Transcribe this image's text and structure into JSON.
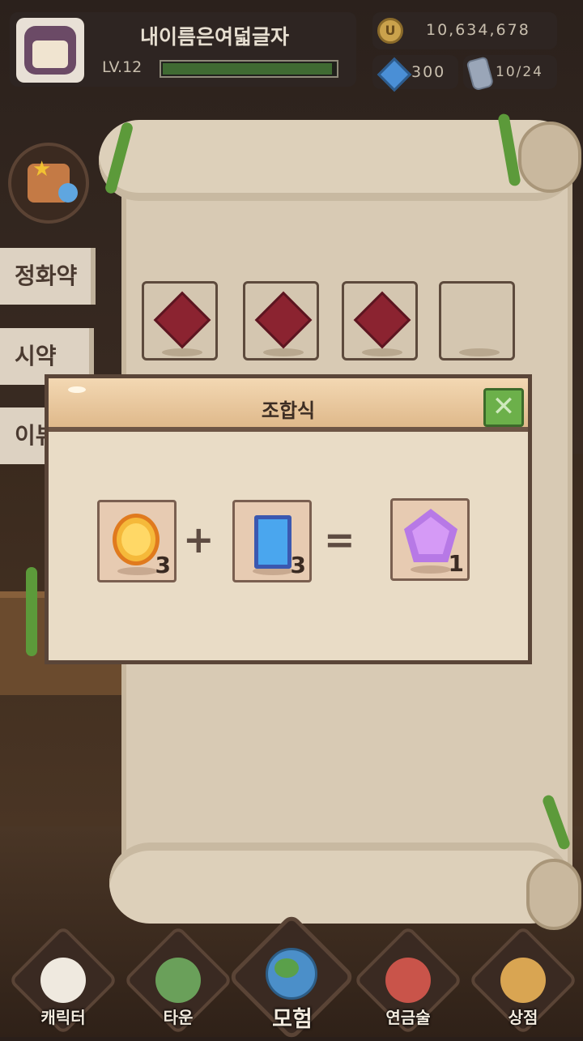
{
  "header": {
    "player_name": "내이름은여덟글자",
    "level": "LV.12",
    "xp_fraction": 0.98,
    "gold": "10,634,678",
    "gold_symbol": "U",
    "gems": "300",
    "stamina": "10/24"
  },
  "side_tabs": [
    "정화약",
    "시약",
    "이뷰"
  ],
  "modal": {
    "title": "조합식",
    "close_label": "✕",
    "ingredients": [
      {
        "item": "gold-coin",
        "qty": "3"
      },
      {
        "item": "blue-card",
        "qty": "3"
      }
    ],
    "plus": "+",
    "equals": "=",
    "result": {
      "item": "purple-gem",
      "qty": "1"
    }
  },
  "nav": {
    "items": [
      {
        "label": "캐릭터"
      },
      {
        "label": "타운"
      },
      {
        "label": "모험"
      },
      {
        "label": "연금술"
      },
      {
        "label": "상점"
      }
    ]
  },
  "colors": {
    "accent_green": "#6cb04a",
    "gem_red": "#8b2330",
    "gem_purple": "#b779e6",
    "coin_gold": "#f5b93a"
  }
}
